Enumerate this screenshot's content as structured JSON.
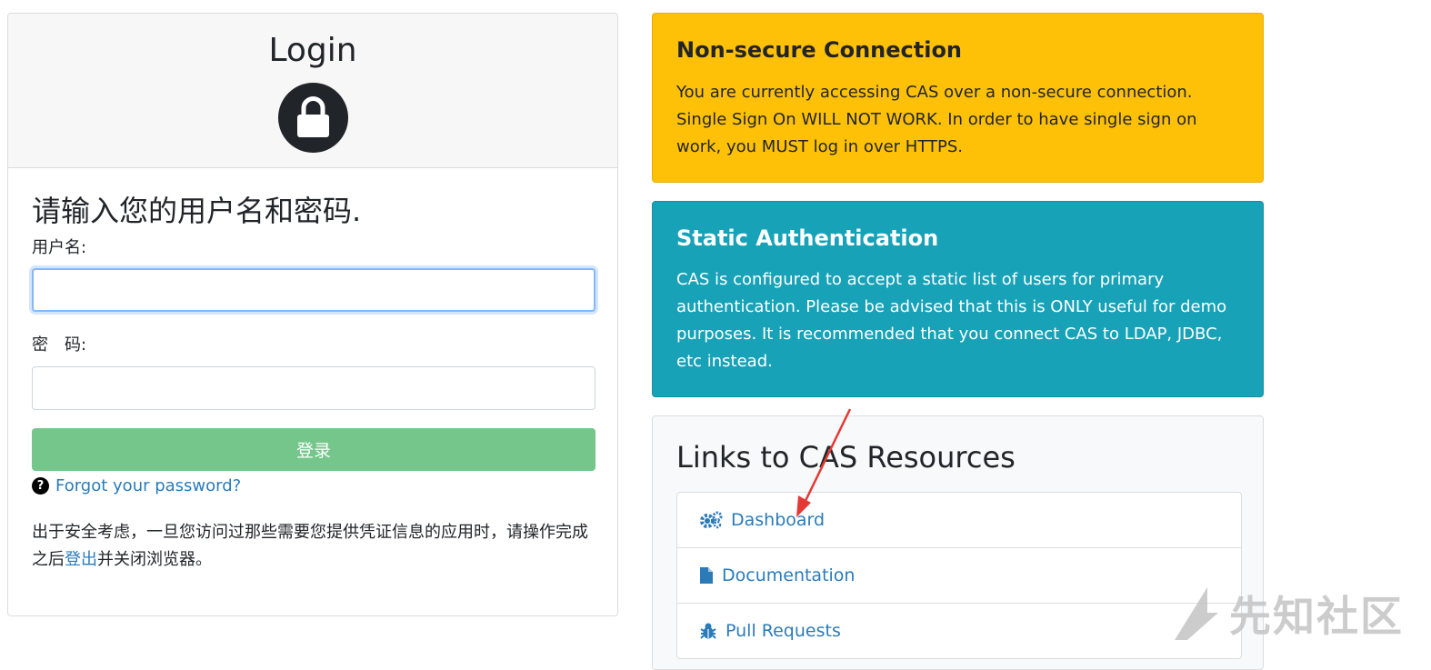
{
  "login": {
    "title": "Login",
    "heading": "请输入您的用户名和密码.",
    "username_label": "用户名:",
    "username_value": "",
    "password_label": "密　码:",
    "password_value": "",
    "submit_label": "登录",
    "forgot_link": "Forgot your password?",
    "security_note_before": "出于安全考虑，一旦您访问过那些需要您提供凭证信息的应用时，请操作完成之后",
    "logout_link": "登出",
    "security_note_after": "并关闭浏览器。"
  },
  "nonsecure": {
    "title": "Non-secure Connection",
    "body": "You are currently accessing CAS over a non-secure connection. Single Sign On WILL NOT WORK. In order to have single sign on work, you MUST log in over HTTPS."
  },
  "static_auth": {
    "title": "Static Authentication",
    "body": "CAS is configured to accept a static list of users for primary authentication. Please be advised that this is ONLY useful for demo purposes. It is recommended that you connect CAS to LDAP, JDBC, etc instead."
  },
  "links": {
    "title": "Links to CAS Resources",
    "items": [
      {
        "label": "Dashboard",
        "icon": "gears-icon"
      },
      {
        "label": "Documentation",
        "icon": "file-icon"
      },
      {
        "label": "Pull Requests",
        "icon": "bug-icon"
      }
    ]
  },
  "watermark": {
    "text": "先知社区"
  },
  "colors": {
    "warning": "#ffc107",
    "info": "#17a2b8",
    "success_button": "#75c68a",
    "link": "#2b7bb9",
    "arrow": "#e53935"
  }
}
